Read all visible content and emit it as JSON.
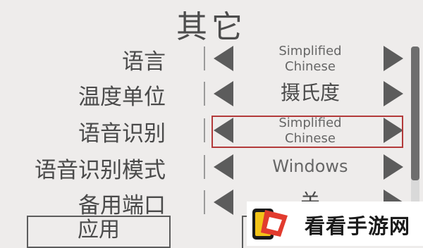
{
  "title": "其它",
  "settings": [
    {
      "label": "语言",
      "value": "Simplified\nChinese"
    },
    {
      "label": "温度单位",
      "value": "摄氏度"
    },
    {
      "label": "语音识别",
      "value": "Simplified\nChinese"
    },
    {
      "label": "语音识别模式",
      "value": "Windows"
    },
    {
      "label": "备用端口",
      "value": "关"
    }
  ],
  "apply_label": "应用",
  "watermark": {
    "text": "看看手游网"
  },
  "colors": {
    "highlight": "#b33a3a",
    "background": "#eeeceb",
    "arrow": "#5c5c5c"
  }
}
